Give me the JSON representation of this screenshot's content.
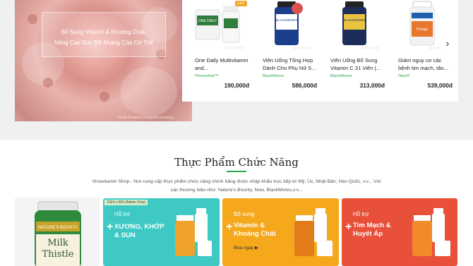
{
  "hero": {
    "faint_title": "",
    "line1": "Bổ Sung Vitamin & Khoáng Chất.",
    "line2": "Nâng Cao Sức Đề Kháng Của Cơ Thể",
    "credit": "Credit: Anatomy Image/Shutterstock"
  },
  "products": [
    {
      "name": "One Daily Multivitamin and...",
      "brand": "Pharmekal™",
      "price": "190,000đ",
      "badge": "Hot",
      "color": "#2e7d3b"
    },
    {
      "name": "Viên Uống Tổng Hợp Dành Cho Phụ Nữ 5...",
      "brand": "BlackMores",
      "price": "586,000đ",
      "badge": "",
      "color": "#1b3f8b"
    },
    {
      "name": "Viên Uống Bổ Sung Vitamin C 31 Viên |...",
      "brand": "BlackMores",
      "price": "313,000đ",
      "badge": "",
      "color": "#1d2d5a"
    },
    {
      "name": "Giảm nguy cơ các bệnh tim mạch, tăn...",
      "brand": "Now®",
      "price": "539,000đ",
      "badge": "",
      "color": "#e8e8e8"
    }
  ],
  "carousel": {
    "next_icon": "›"
  },
  "section": {
    "title": "Thực Phẩm Chức Năng",
    "desc_line1": "Vinavitamin Shop - Nơi cung cấp thực phẩm chức năng chính hãng được nhập khẩu trực tiếp từ Mỹ, Úc, Nhật Bản, Hàn Quốc, v.v... Với",
    "desc_line2": "các thương hiệu như: Nature's Bounty, Now, BlackMores,v.v..."
  },
  "featured": {
    "brand_top": "NATURE'S BOUNTY",
    "name1": "Milk",
    "name2": "Thistle"
  },
  "banners": [
    {
      "small": "Hỗ trợ",
      "big": "XƯƠNG, KHỚP & SỤN",
      "more": "",
      "tag": "1024 x 550 (Admin Only)",
      "bg": "#3ec9c4"
    },
    {
      "small": "Bổ sung",
      "big": "Vitamin & Khoáng Chất",
      "more": "Mua ngay ▶",
      "tag": "",
      "bg": "#f5a81c"
    },
    {
      "small": "Hỗ trợ",
      "big": "Tim Mạch & Huyết Áp",
      "more": "",
      "tag": "",
      "bg": "#e8503a"
    }
  ]
}
